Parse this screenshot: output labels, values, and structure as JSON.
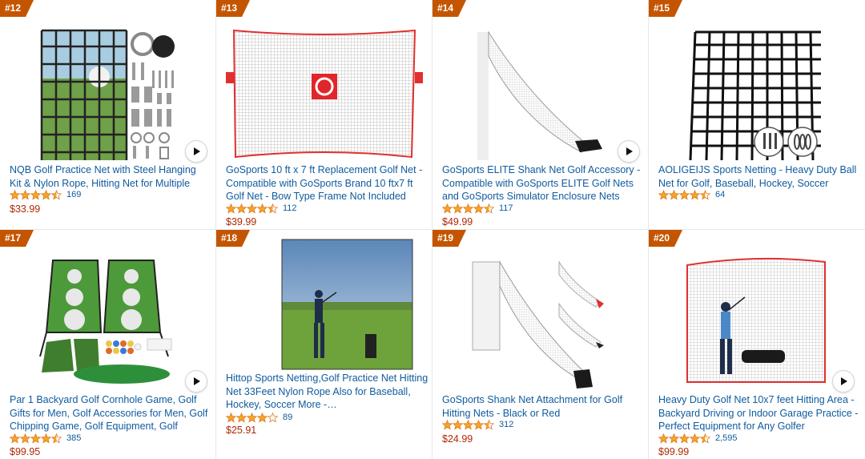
{
  "products": [
    {
      "rank": "#12",
      "title": "NQB Golf Practice Net with Steel Hanging Kit & Nylon Rope, Hitting Net for Multiple Sports",
      "rating": 4.5,
      "reviews": "169",
      "price": "$33.99",
      "has_video": true
    },
    {
      "rank": "#13",
      "title": "GoSports 10 ft x 7 ft Replacement Golf Net - Compatible with GoSports Brand 10 ftx7 ft Golf Net - Bow Type Frame Not Included",
      "rating": 4.5,
      "reviews": "112",
      "price": "$39.99",
      "has_video": false
    },
    {
      "rank": "#14",
      "title": "GoSports ELITE Shank Net Golf Accessory - Compatible with GoSports ELITE Golf Nets and GoSports Simulator Enclosure Nets",
      "rating": 4.5,
      "reviews": "117",
      "price": "$49.99",
      "has_video": true
    },
    {
      "rank": "#15",
      "title": "AOLIGEIJS Sports Netting - Heavy Duty Ball Net for Golf, Baseball, Hockey, Soccer",
      "rating": 4.5,
      "reviews": "64",
      "price": "",
      "has_video": false
    },
    {
      "rank": "#17",
      "title": "Par 1 Backyard Golf Cornhole Game, Golf Gifts for Men, Golf Accessories for Men, Golf Chipping Game, Golf Equipment, Golf Games…",
      "rating": 4.5,
      "reviews": "385",
      "price": "$99.95",
      "has_video": true
    },
    {
      "rank": "#18",
      "title": "Hittop Sports Netting,Golf Practice Net Hitting Net 33Feet Nylon Rope Also for Baseball, Hockey, Soccer More -…",
      "rating": 4.0,
      "reviews": "89",
      "price": "$25.91",
      "has_video": false
    },
    {
      "rank": "#19",
      "title": "GoSports Shank Net Attachment for Golf Hitting Nets - Black or Red",
      "rating": 4.5,
      "reviews": "312",
      "price": "$24.99",
      "has_video": false
    },
    {
      "rank": "#20",
      "title": "Heavy Duty Golf Net 10x7 feet Hitting Area - Backyard Driving or Indoor Garage Practice - Perfect Equipment for Any Golfer",
      "rating": 4.5,
      "reviews": "2,595",
      "price": "$99.99",
      "has_video": true
    }
  ],
  "icons": {
    "star": "star-icon",
    "play": "play-icon"
  },
  "colors": {
    "rank_badge": "#c45500",
    "link": "#0f5a9e",
    "price": "#b12704",
    "star": "#f5a524"
  }
}
